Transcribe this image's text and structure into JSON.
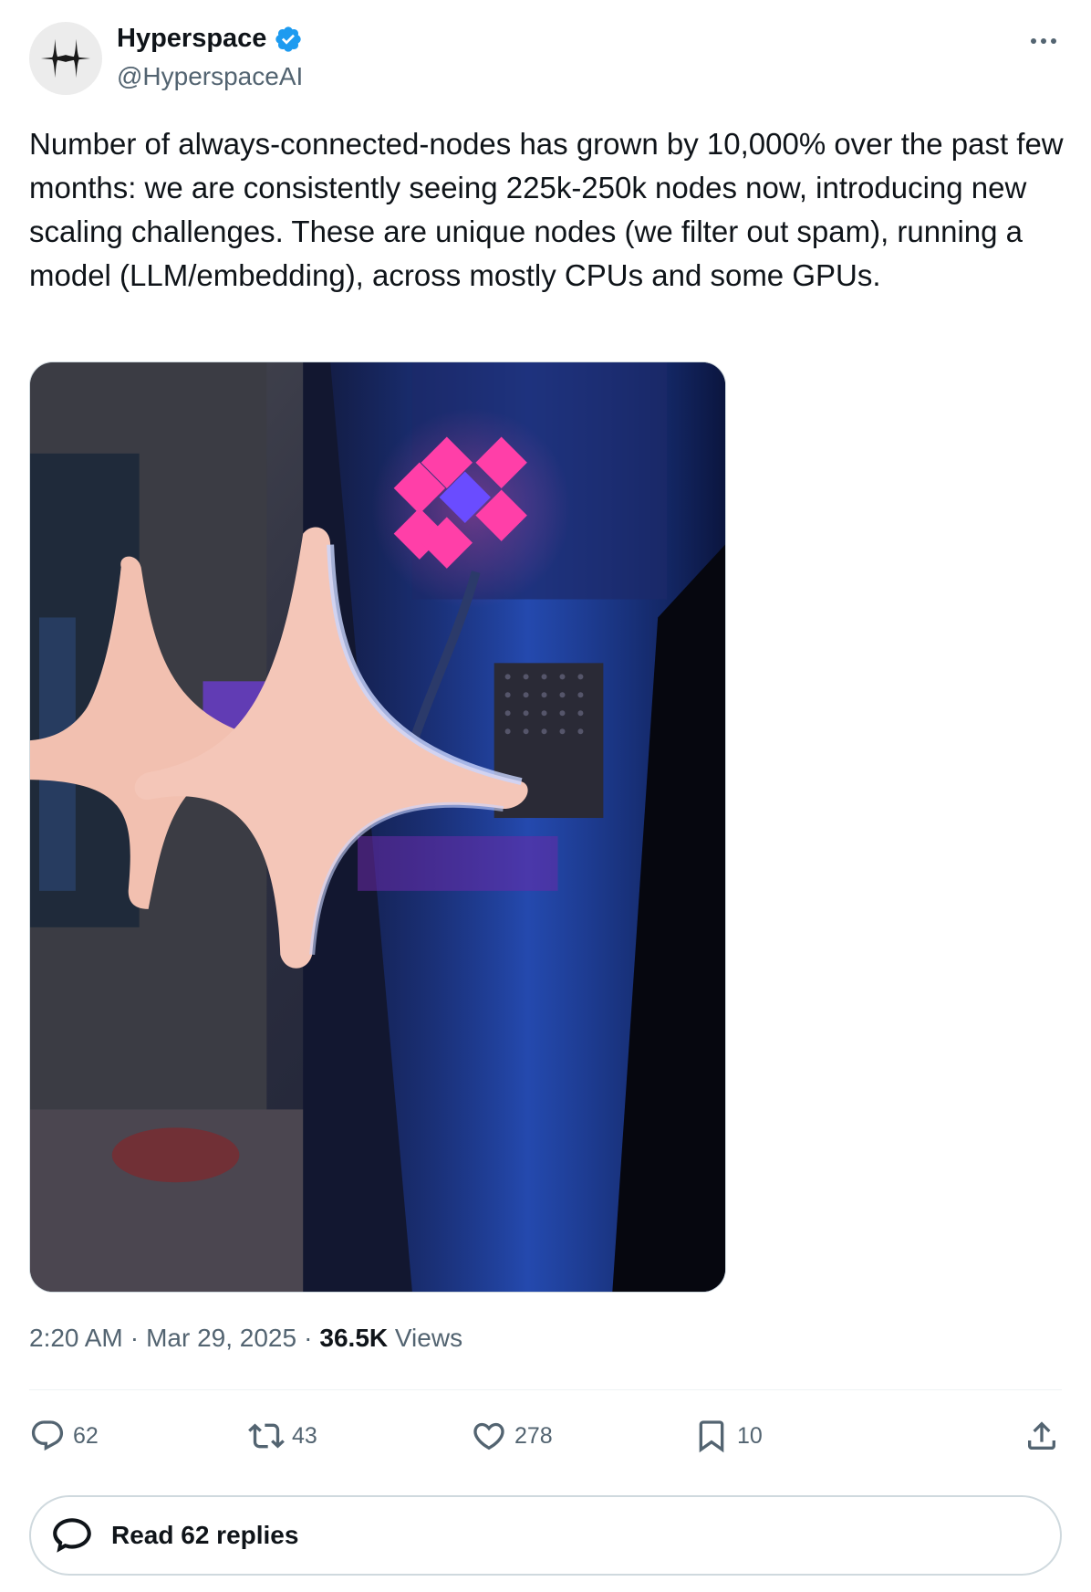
{
  "author": {
    "display_name": "Hyperspace",
    "handle": "@HyperspaceAI",
    "verified": true
  },
  "tweet": {
    "text": "Number of always-connected-nodes has grown by 10,000% over the past few months: we are consistently seeing 225k-250k nodes now, introducing new scaling challenges. These are unique nodes (we filter out spam), running a model (LLM/embedding), across mostly CPUs and some GPUs."
  },
  "meta": {
    "time": "2:20 AM",
    "separator": "·",
    "date": "Mar 29, 2025",
    "views_count": "36.5K",
    "views_label": "Views"
  },
  "actions": {
    "reply": "62",
    "retweet": "43",
    "like": "278",
    "bookmark": "10"
  },
  "read_replies": {
    "label": "Read 62 replies"
  },
  "icons": {
    "more": "more-icon",
    "verified": "verified-badge-icon",
    "reply": "reply-icon",
    "retweet": "retweet-icon",
    "like": "heart-icon",
    "bookmark": "bookmark-icon",
    "share": "share-icon",
    "read_replies": "speech-bubble-icon"
  },
  "colors": {
    "text_primary": "#0f1419",
    "text_secondary": "#536471",
    "verified_blue": "#1d9bf0",
    "border": "#cfd9de"
  }
}
